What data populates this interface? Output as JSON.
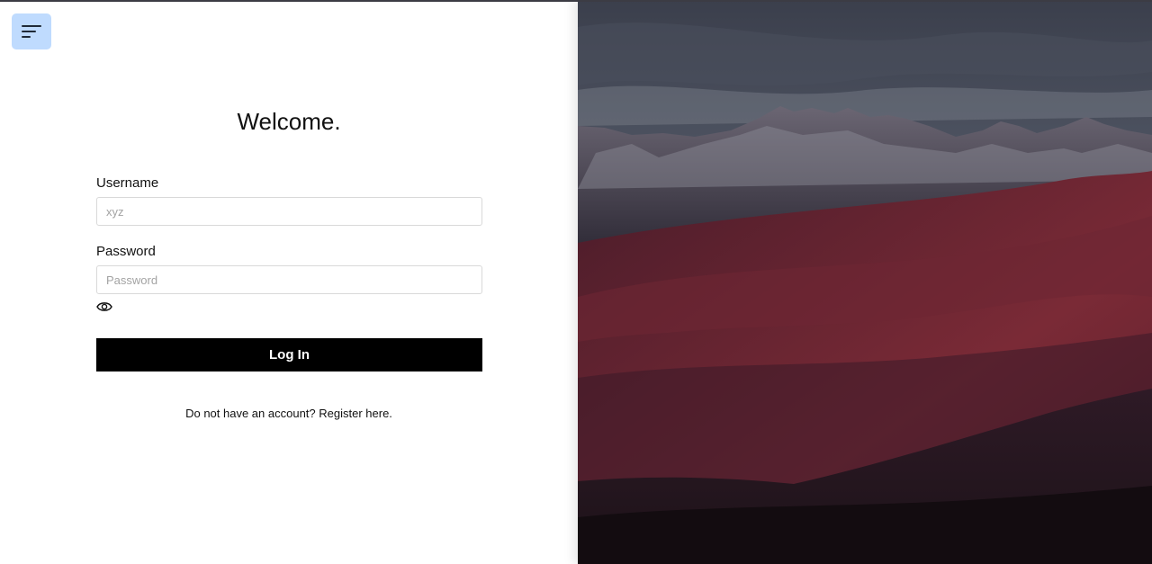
{
  "menu_icon": "hamburger-menu-icon",
  "title": "Welcome.",
  "form": {
    "username_label": "Username",
    "username_placeholder": "xyz",
    "password_label": "Password",
    "password_placeholder": "Password",
    "show_password_icon": "eye-icon",
    "login_label": "Log In"
  },
  "register_text": "Do not have an account? Register here.",
  "colors": {
    "menu_button_bg": "#bfdbfe",
    "login_button_bg": "#000000",
    "login_button_text": "#ffffff"
  },
  "background_image": "mountain-landscape-dusk"
}
